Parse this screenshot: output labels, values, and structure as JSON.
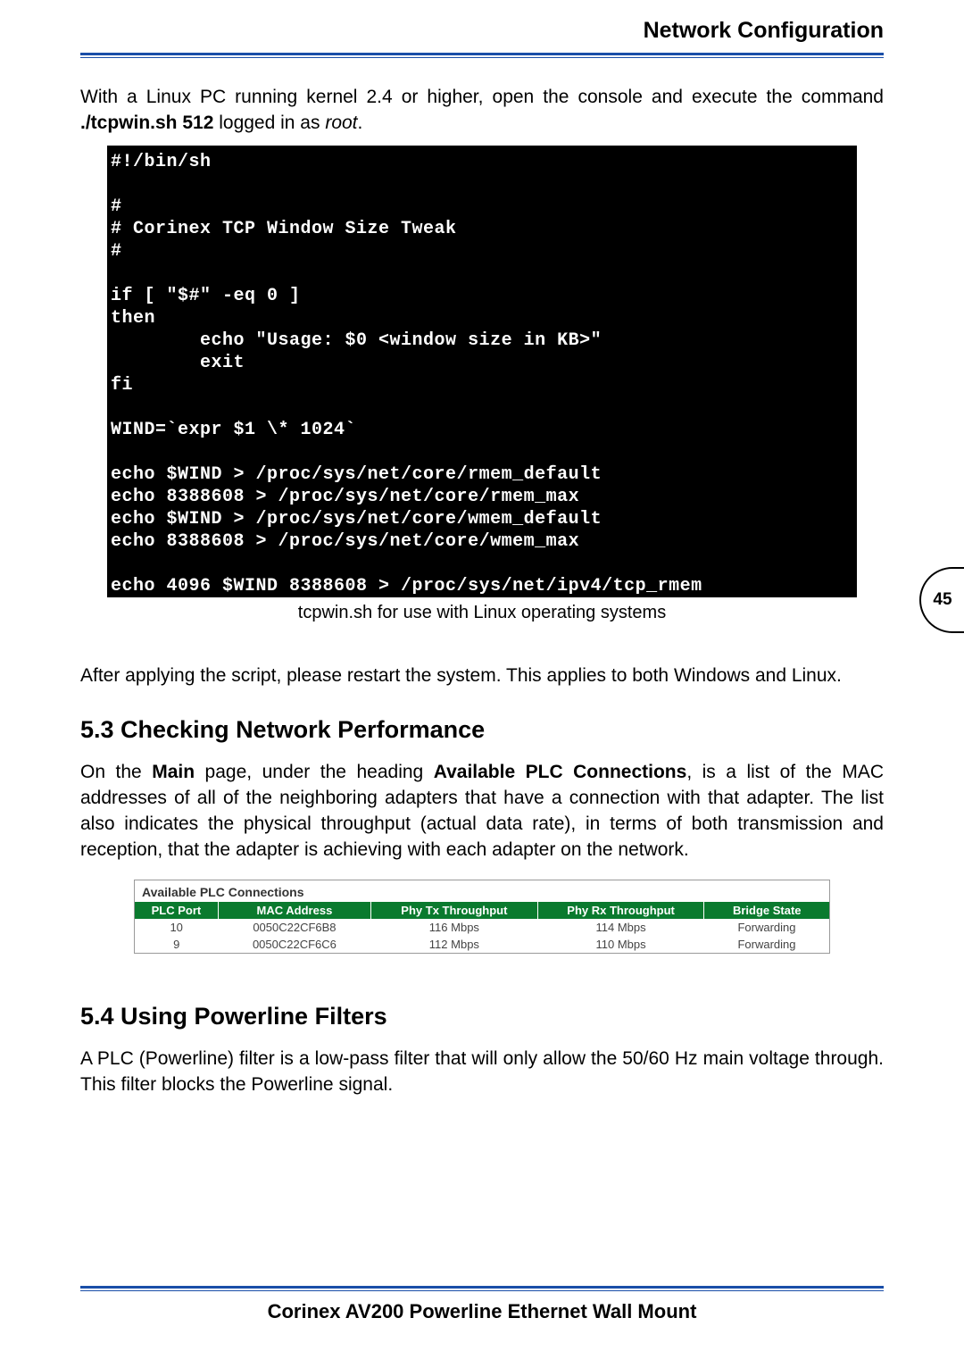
{
  "header": {
    "title": "Network Configuration"
  },
  "intro": {
    "prefix": "With a Linux PC running kernel 2.4 or higher, open the console and execute the command ",
    "cmd": "./tcpwin.sh 512",
    "mid": " logged in as ",
    "user": "root",
    "suffix": "."
  },
  "terminal": "#!/bin/sh\n\n#\n# Corinex TCP Window Size Tweak\n#\n\nif [ \"$#\" -eq 0 ]\nthen\n        echo \"Usage: $0 <window size in KB>\"\n        exit\nfi\n\nWIND=`expr $1 \\* 1024`\n\necho $WIND > /proc/sys/net/core/rmem_default\necho 8388608 > /proc/sys/net/core/rmem_max\necho $WIND > /proc/sys/net/core/wmem_default\necho 8388608 > /proc/sys/net/core/wmem_max\n\necho 4096 $WIND 8388608 > /proc/sys/net/ipv4/tcp_rmem",
  "caption": "tcpwin.sh for use with Linux operating systems",
  "after_script": "After applying the script, please restart the system. This applies to both Windows and Linux.",
  "page_number": "45",
  "section_53": {
    "heading": "5.3 Checking Network Performance",
    "p1_a": "On the ",
    "p1_b": "Main",
    "p1_c": " page, under the heading ",
    "p1_d": "Available PLC Connections",
    "p1_e": ", is a list of the MAC addresses of all of the neighboring adapters that have a connection with that adapter. The list also indicates the physical throughput (actual data rate), in terms of both transmission and reception, that the adapter is achieving with each adapter on the network."
  },
  "plc": {
    "title": "Available PLC Connections",
    "headers": [
      "PLC Port",
      "MAC Address",
      "Phy Tx Throughput",
      "Phy Rx Throughput",
      "Bridge State"
    ],
    "rows": [
      {
        "port": "10",
        "mac": "0050C22CF6B8",
        "tx": "116 Mbps",
        "rx": "114 Mbps",
        "state": "Forwarding"
      },
      {
        "port": "9",
        "mac": "0050C22CF6C6",
        "tx": "112 Mbps",
        "rx": "110 Mbps",
        "state": "Forwarding"
      }
    ]
  },
  "section_54": {
    "heading": "5.4 Using Powerline Filters",
    "p1": "A PLC (Powerline) filter is a low-pass filter that will only allow the 50/60 Hz main voltage through. This filter blocks the Powerline signal."
  },
  "footer": {
    "product": "Corinex AV200 Powerline Ethernet Wall Mount"
  }
}
